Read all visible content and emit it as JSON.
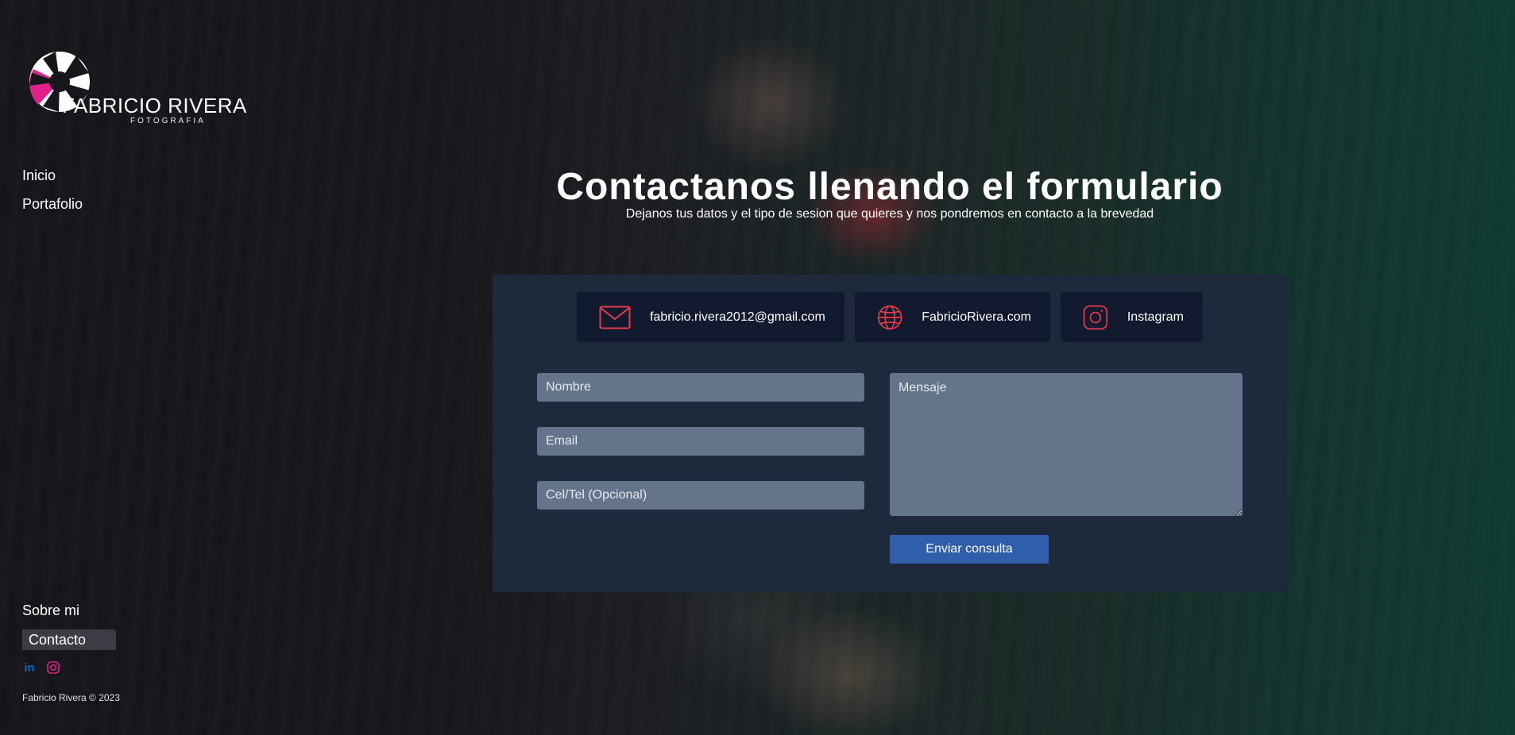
{
  "brand": {
    "name": "FABRICIO RIVERA",
    "tagline": "FOTOGRAFIA",
    "accent_color": "#e0218a",
    "icon_color": "#e23c4a"
  },
  "nav": {
    "top_items": [
      {
        "label": "Inicio"
      },
      {
        "label": "Portafolio"
      }
    ],
    "bottom_items": [
      {
        "label": "Sobre mi"
      },
      {
        "label": "Contacto",
        "active": true
      }
    ]
  },
  "socials": [
    {
      "icon": "linkedin-icon",
      "label": "in",
      "color": "#0a66c2"
    },
    {
      "icon": "instagram-icon",
      "color": "#e0218a"
    }
  ],
  "footer": {
    "copyright": "Fabricio Rivera © 2023"
  },
  "main": {
    "title": "Contactanos llenando el formulario",
    "subtitle": "Dejanos tus datos y el tipo de sesion que quieres y nos pondremos en contacto a la brevedad"
  },
  "contact_cards": [
    {
      "icon": "mail-icon",
      "label": "fabricio.rivera2012@gmail.com"
    },
    {
      "icon": "globe-icon",
      "label": "FabricioRivera.com"
    },
    {
      "icon": "instagram-icon",
      "label": "Instagram"
    }
  ],
  "form": {
    "name_placeholder": "Nombre",
    "email_placeholder": "Email",
    "phone_placeholder": "Cel/Tel (Opcional)",
    "message_placeholder": "Mensaje",
    "submit_label": "Enviar consulta"
  }
}
